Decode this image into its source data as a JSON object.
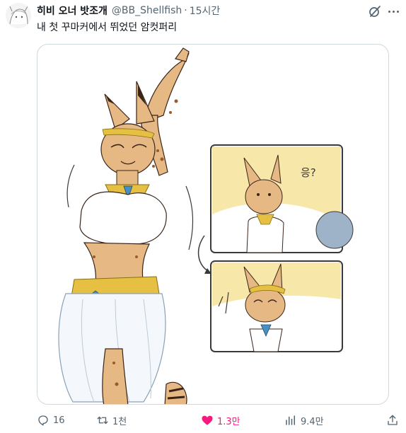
{
  "post": {
    "display_name": "히비 오너 밧조개",
    "handle": "@BB_Shellfish",
    "separator": "·",
    "time": "15시간",
    "text": "내 첫 꾸마커에서 뛰었던 암컷퍼리",
    "icons": {
      "grok": "grok-slash-icon",
      "more": "more-dots-icon",
      "avatar": "avatar-sketch"
    }
  },
  "media": {
    "alt_icon": "illustration",
    "speech_bubble": "응?",
    "colors": {
      "fur": "#e6b884",
      "fur_dark": "#3a2418",
      "gold": "#e5c043",
      "cloth": "#ffffff",
      "panel_bg": "#f7e7a8",
      "panel_border": "#3a3a3a",
      "gem": "#4a8fc2",
      "ball": "#9fb3c8"
    }
  },
  "actions": {
    "reply": {
      "icon": "reply-icon",
      "count": "16"
    },
    "repost": {
      "icon": "repost-icon",
      "count": "1천"
    },
    "like": {
      "icon": "heart-filled-icon",
      "count": "1.3만",
      "liked": true,
      "color": "#f91880"
    },
    "views": {
      "icon": "views-icon",
      "count": "9.4만"
    },
    "share": {
      "icon": "share-icon"
    }
  }
}
